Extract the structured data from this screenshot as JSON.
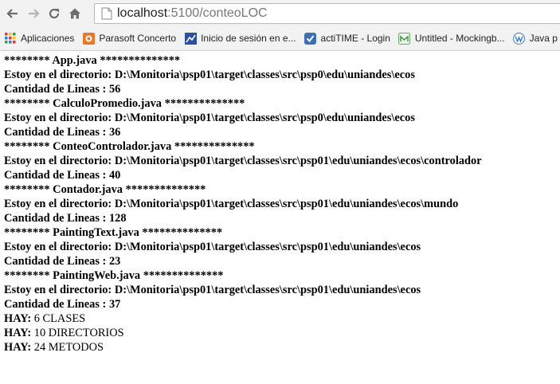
{
  "browser": {
    "url": "localhost:5100/conteoLOC",
    "url_host": "localhost",
    "url_rest": ":5100/conteoLOC",
    "bookmarks": [
      {
        "label": "Aplicaciones",
        "icon": "apps-grid-icon"
      },
      {
        "label": "Parasoft Concerto",
        "icon": "parasoft-icon"
      },
      {
        "label": "Inicio de sesión en e...",
        "icon": "chart-icon"
      },
      {
        "label": "actiTIME - Login",
        "icon": "actitime-icon"
      },
      {
        "label": "Untitled - Mockingb...",
        "icon": "mockingbird-icon"
      },
      {
        "label": "Java p",
        "icon": "wordpress-icon"
      }
    ]
  },
  "report": {
    "files": [
      {
        "stars_left": "********",
        "name": "App.java",
        "stars_right": "**************",
        "dir_label": "Estoy en el directorio:",
        "dir": "D:\\Monitoria\\psp01\\target\\classes\\src\\psp0\\edu\\uniandes\\ecos",
        "count_label": "Cantidad de Lineas :",
        "count": "56"
      },
      {
        "stars_left": "********",
        "name": "CalculoPromedio.java",
        "stars_right": "**************",
        "dir_label": "Estoy en el directorio:",
        "dir": "D:\\Monitoria\\psp01\\target\\classes\\src\\psp0\\edu\\uniandes\\ecos",
        "count_label": "Cantidad de Lineas :",
        "count": "36"
      },
      {
        "stars_left": "********",
        "name": "ConteoControlador.java",
        "stars_right": "**************",
        "dir_label": "Estoy en el directorio:",
        "dir": "D:\\Monitoria\\psp01\\target\\classes\\src\\psp01\\edu\\uniandes\\ecos\\controlador",
        "count_label": "Cantidad de Lineas :",
        "count": "40"
      },
      {
        "stars_left": "********",
        "name": "Contador.java",
        "stars_right": "**************",
        "dir_label": "Estoy en el directorio:",
        "dir": "D:\\Monitoria\\psp01\\target\\classes\\src\\psp01\\edu\\uniandes\\ecos\\mundo",
        "count_label": "Cantidad de Lineas :",
        "count": "128"
      },
      {
        "stars_left": "********",
        "name": "PaintingText.java",
        "stars_right": "**************",
        "dir_label": "Estoy en el directorio:",
        "dir": "D:\\Monitoria\\psp01\\target\\classes\\src\\psp01\\edu\\uniandes\\ecos",
        "count_label": "Cantidad de Lineas :",
        "count": "23"
      },
      {
        "stars_left": "********",
        "name": "PaintingWeb.java",
        "stars_right": "**************",
        "dir_label": "Estoy en el directorio:",
        "dir": "D:\\Monitoria\\psp01\\target\\classes\\src\\psp01\\edu\\uniandes\\ecos",
        "count_label": "Cantidad de Lineas :",
        "count": "37"
      }
    ],
    "summary": [
      {
        "label": "HAY:",
        "value": "6 CLASES"
      },
      {
        "label": "HAY:",
        "value": "10 DIRECTORIOS"
      },
      {
        "label": "HAY:",
        "value": "24 METODOS"
      }
    ]
  }
}
